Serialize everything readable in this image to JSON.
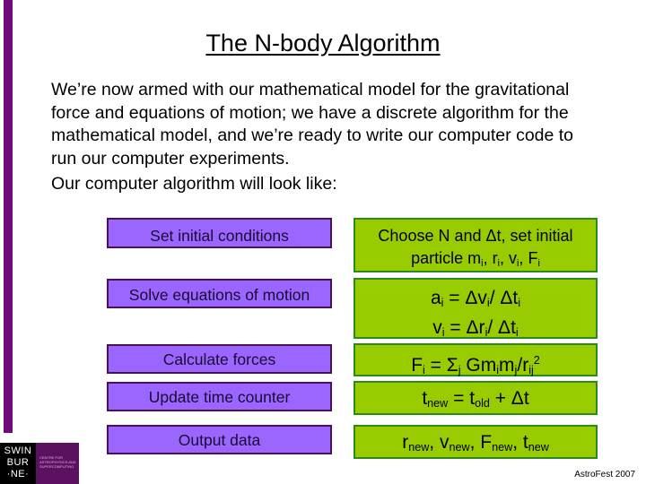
{
  "title": "The N-body Algorithm",
  "intro": "We’re now armed with our mathematical model for the gravitational force and equations of motion; we have a discrete algorithm for the mathematical model, and we’re ready to write our computer code to run our computer experiments.",
  "lead": "Our computer algorithm will look like:",
  "steps": [
    {
      "label": "Set initial conditions"
    },
    {
      "label": "Solve equations of motion"
    },
    {
      "label": "Calculate forces"
    },
    {
      "label": "Update time counter"
    },
    {
      "label": "Output data"
    }
  ],
  "details": {
    "d1_line1": "Choose N and Δt, set initial",
    "d1_line2_prefix": "particle m",
    "sub_i": "i",
    "sub_j": "j",
    "sub_ij": "ij",
    "sub_new": "new",
    "sub_old": "old",
    "r": "r",
    "v": "v",
    "F": "F",
    "a": "a",
    "t": "t",
    "comma": ", ",
    "eq": " = ",
    "slash_dt": "/ Δt",
    "dv": "Δv",
    "dr": "Δr",
    "sigma": "Σ",
    "Gm": " Gm",
    "m": "m",
    "slash_r": "/r",
    "sq": "2",
    "plus_dt": " + Δt"
  },
  "logo": {
    "top": "SWIN",
    "mid": "BUR",
    "bottom": "·NE·",
    "tagline": "CENTRE FOR ASTROPHYSICS AND SUPERCOMPUTING"
  },
  "footer": "AstroFest 2007",
  "colors": {
    "purple_box": "#9b66ff",
    "green_box": "#99cc00",
    "side_bar": "#6e0a7a"
  }
}
